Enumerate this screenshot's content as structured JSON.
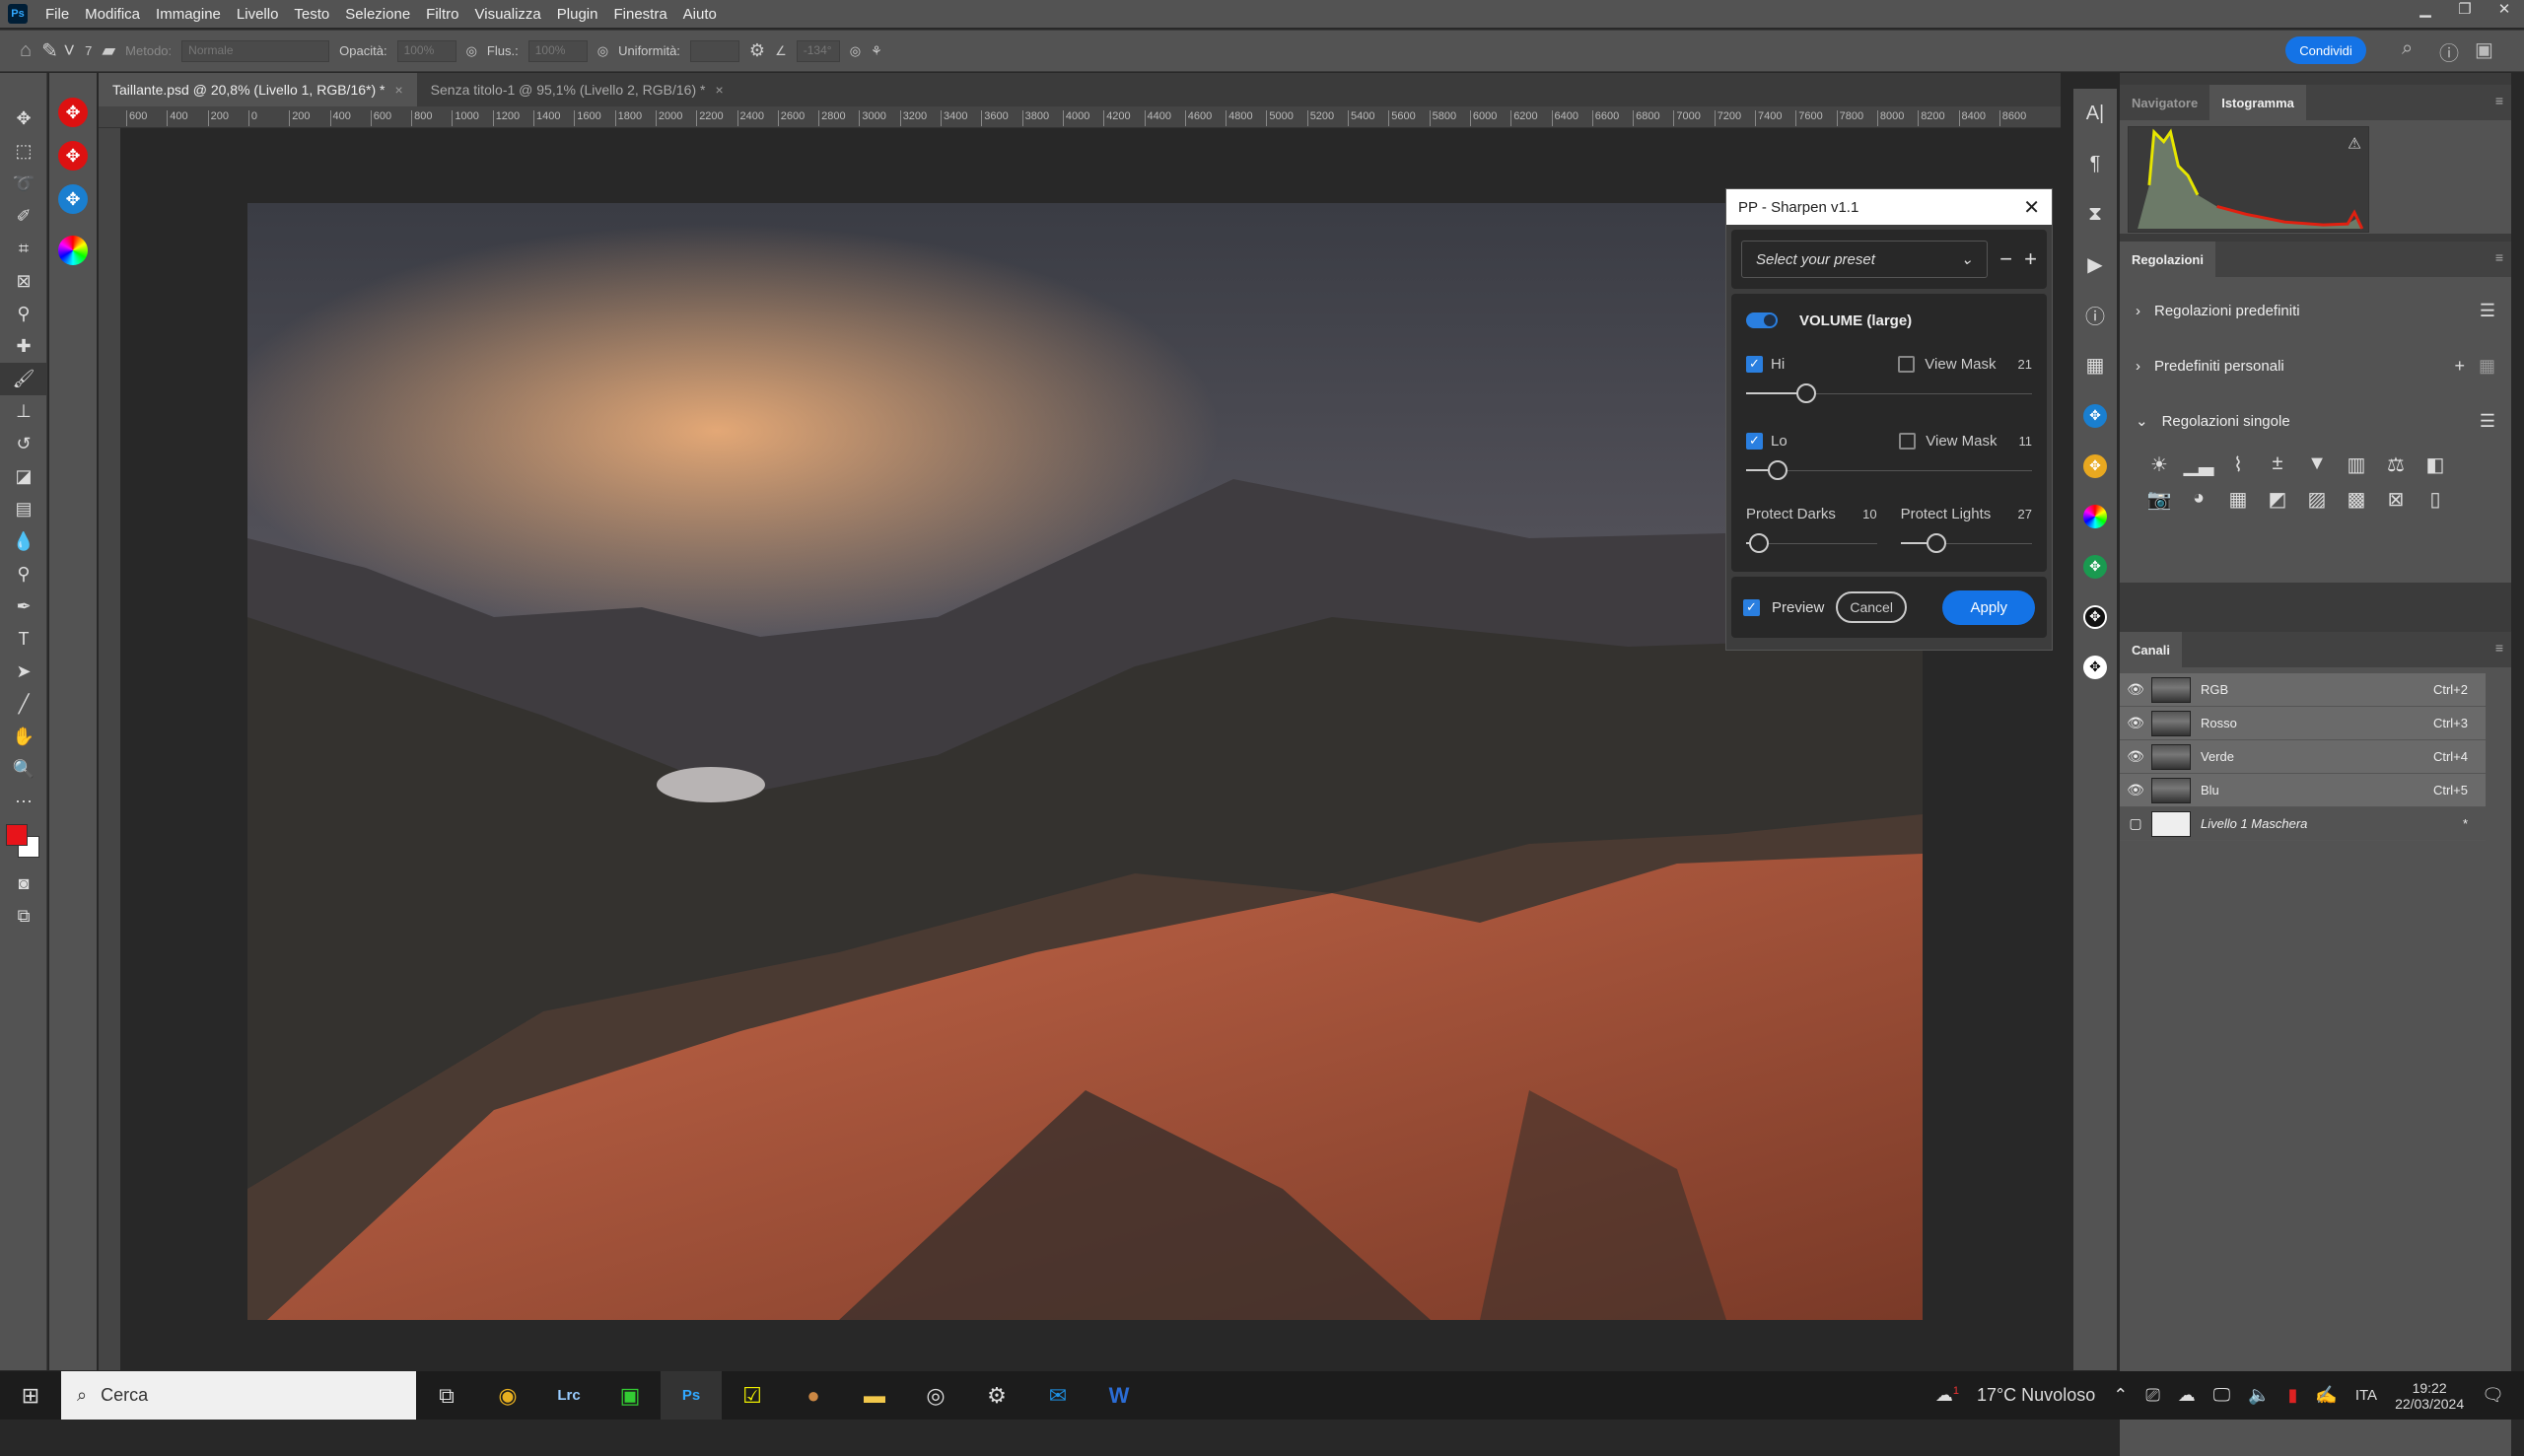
{
  "app": {
    "logo": "Ps",
    "menu": [
      "File",
      "Modifica",
      "Immagine",
      "Livello",
      "Testo",
      "Selezione",
      "Filtro",
      "Visualizza",
      "Plugin",
      "Finestra",
      "Aiuto"
    ]
  },
  "options": {
    "brush_size": "7",
    "method_label": "Metodo:",
    "method_value": "Normale",
    "opacity_label": "Opacità:",
    "opacity_value": "100%",
    "flow_label": "Flus.:",
    "flow_value": "100%",
    "smoothing_label": "Uniformità:",
    "angle_value": "-134°",
    "share": "Condividi"
  },
  "tabs": [
    {
      "label": "Taillante.psd @ 20,8% (Livello 1, RGB/16*) *",
      "active": true
    },
    {
      "label": "Senza titolo-1 @ 95,1% (Livello 2, RGB/16) *",
      "active": false
    }
  ],
  "ruler": [
    "600",
    "400",
    "200",
    "0",
    "200",
    "400",
    "600",
    "800",
    "1000",
    "1200",
    "1400",
    "1600",
    "1800",
    "2000",
    "2200",
    "2400",
    "2600",
    "2800",
    "3000",
    "3200",
    "3400",
    "3600",
    "3800",
    "4000",
    "4200",
    "4400",
    "4600",
    "4800",
    "5000",
    "5200",
    "5400",
    "5600",
    "5800",
    "6000",
    "6200",
    "6400",
    "6600",
    "6800",
    "7000",
    "7200",
    "7400",
    "7600",
    "7800",
    "8000",
    "8200",
    "8400",
    "8600"
  ],
  "colors": {
    "foreground": "#e8141a",
    "background": "#ffffff",
    "accent": "#1473e6",
    "dialog_accent": "#2a7fe0"
  },
  "dialog": {
    "title": "PP - Sharpen v1.1",
    "preset_placeholder": "Select your preset",
    "module": "VOLUME (large)",
    "module_enabled": true,
    "hi": {
      "label": "Hi",
      "checked": true,
      "view_mask": "View Mask",
      "view_mask_checked": false,
      "value": "21"
    },
    "lo": {
      "label": "Lo",
      "checked": true,
      "view_mask": "View Mask",
      "view_mask_checked": false,
      "value": "11"
    },
    "protect_darks": {
      "label": "Protect Darks",
      "value": "10"
    },
    "protect_lights": {
      "label": "Protect Lights",
      "value": "27"
    },
    "preview": "Preview",
    "preview_checked": true,
    "cancel": "Cancel",
    "apply": "Apply"
  },
  "panels": {
    "hist_tabs": [
      "Navigatore",
      "Istogramma"
    ],
    "adj_title": "Regolazioni",
    "adj_sections": [
      "Regolazioni predefiniti",
      "Predefiniti personali",
      "Regolazioni singole"
    ],
    "adj_icons": [
      "brightness-icon",
      "levels-icon",
      "curves-icon",
      "exposure-icon",
      "vibrance-icon",
      "hue-saturation-icon",
      "color-balance-icon",
      "black-white-icon",
      "photo-filter-icon",
      "channel-mixer-icon",
      "color-lookup-icon",
      "invert-icon",
      "posterize-icon",
      "threshold-icon",
      "selective-color-icon",
      "gradient-map-icon"
    ],
    "channels_title": "Canali",
    "channels": [
      {
        "name": "RGB",
        "shortcut": "Ctrl+2"
      },
      {
        "name": "Rosso",
        "shortcut": "Ctrl+3"
      },
      {
        "name": "Verde",
        "shortcut": "Ctrl+4"
      },
      {
        "name": "Blu",
        "shortcut": "Ctrl+5"
      },
      {
        "name": "Livello 1 Maschera",
        "shortcut": "*"
      }
    ]
  },
  "taskbar": {
    "search": "Cerca",
    "weather": "17°C  Nuvoloso",
    "weather_badge": "1",
    "lang": "ITA",
    "time": "19:22",
    "date": "22/03/2024"
  }
}
